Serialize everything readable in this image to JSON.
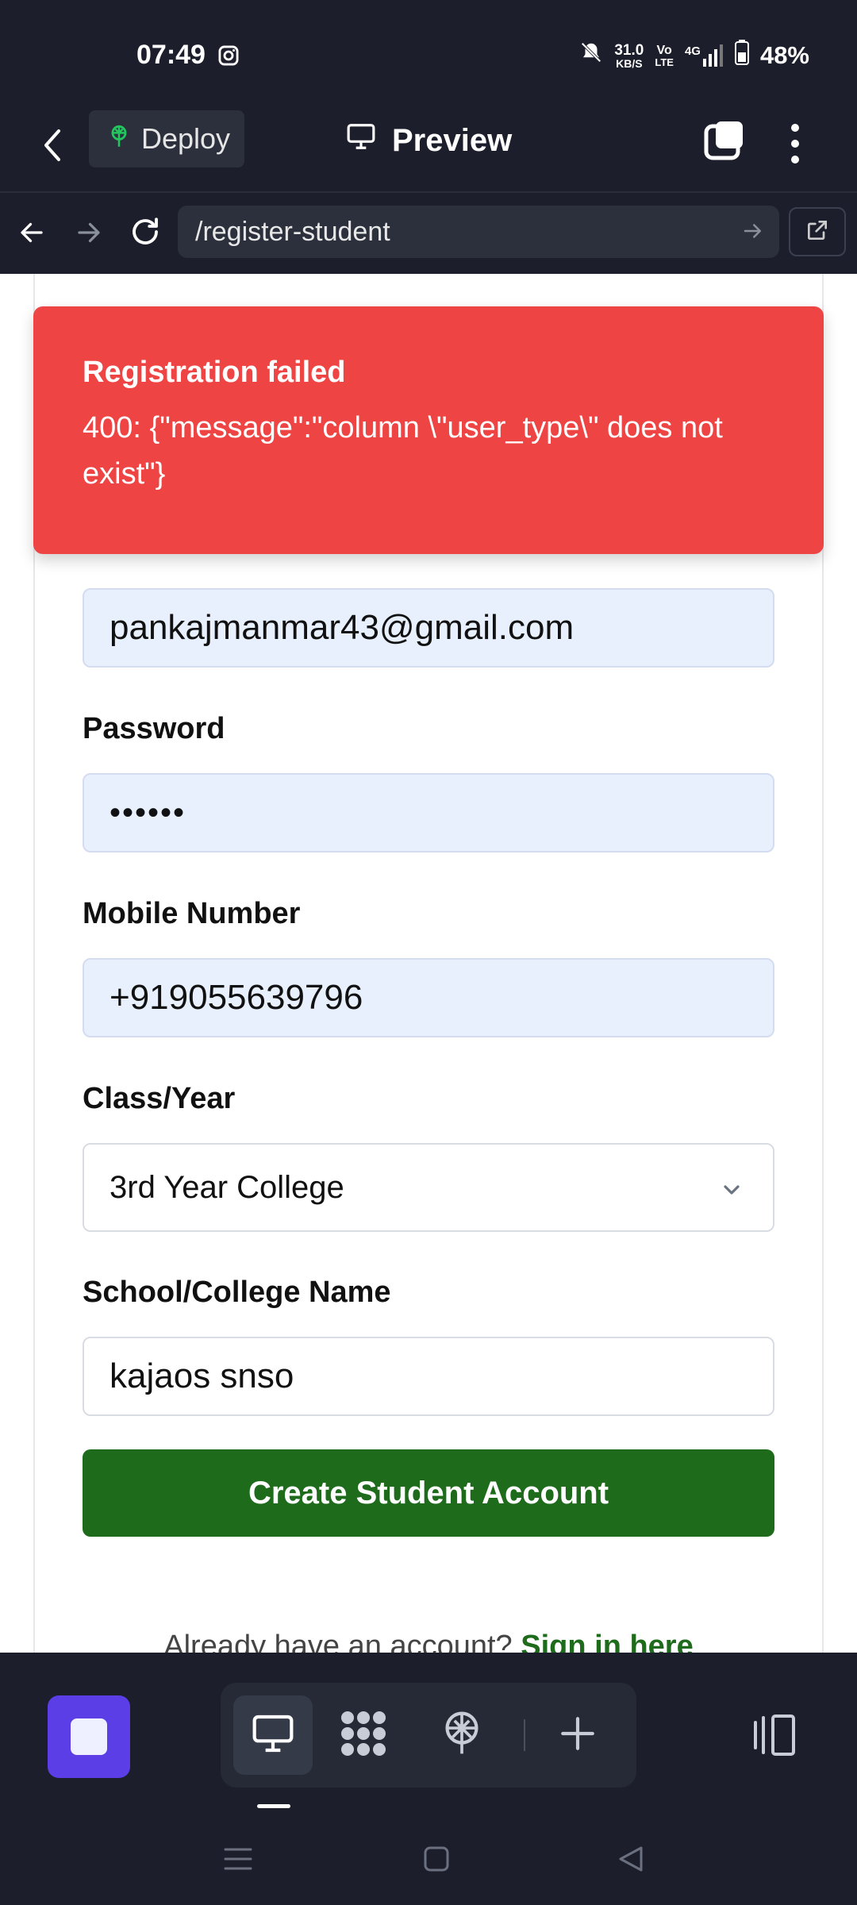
{
  "status": {
    "time": "07:49",
    "net_speed_top": "31.0",
    "net_speed_bottom": "KB/S",
    "volte_top": "Vo",
    "volte_bottom": "LTE",
    "network": "4G",
    "battery": "48%"
  },
  "appbar": {
    "deploy_label": "Deploy",
    "title": "Preview"
  },
  "urlbar": {
    "url": "/register-student"
  },
  "toast": {
    "title": "Registration failed",
    "message": "400: {\"message\":\"column \\\"user_type\\\" does not exist\"}"
  },
  "form": {
    "email_value": "pankajmanmar43@gmail.com",
    "password_label": "Password",
    "password_value": "••••••",
    "mobile_label": "Mobile Number",
    "mobile_value": "+919055639796",
    "class_label": "Class/Year",
    "class_value": "3rd Year College",
    "school_label": "School/College Name",
    "school_value": "kajaos snso",
    "submit_label": "Create Student Account",
    "signin_prompt": "Already have an account?",
    "signin_link": "Sign in here"
  },
  "colors": {
    "toast_bg": "#ef4444",
    "primary_green": "#1e6b1c",
    "accent_purple": "#5b3ee6",
    "chrome_bg": "#1c1f2b"
  },
  "toolbar": {
    "icons": [
      "desktop-icon",
      "modules-icon",
      "deploy-icon",
      "add-icon",
      "panel-icon"
    ]
  }
}
